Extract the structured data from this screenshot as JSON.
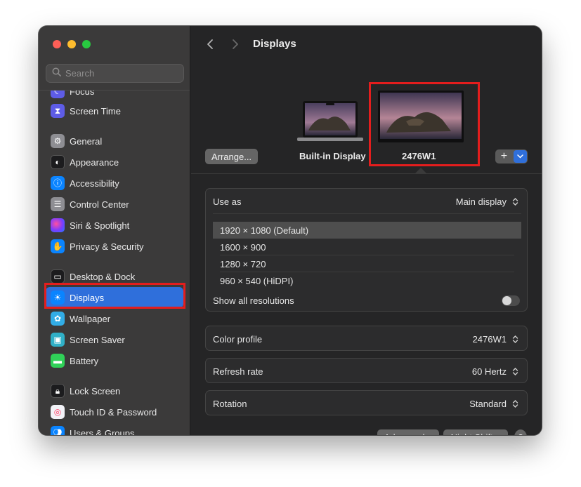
{
  "sidebar": {
    "search_placeholder": "Search",
    "items": [
      {
        "label": "Focus",
        "icon": "moon-icon",
        "color": "#5e5ce6"
      },
      {
        "label": "Screen Time",
        "icon": "hourglass-icon",
        "color": "#5e5ce6"
      },
      {
        "label": "General",
        "icon": "gear-icon",
        "color": "#8e8e93"
      },
      {
        "label": "Appearance",
        "icon": "appearance-icon",
        "color": "#1c1c1e"
      },
      {
        "label": "Accessibility",
        "icon": "accessibility-icon",
        "color": "#0a84ff"
      },
      {
        "label": "Control Center",
        "icon": "toggles-icon",
        "color": "#8e8e93"
      },
      {
        "label": "Siri & Spotlight",
        "icon": "siri-icon",
        "color": "#7a3cff"
      },
      {
        "label": "Privacy & Security",
        "icon": "hand-icon",
        "color": "#0a84ff"
      },
      {
        "label": "Desktop & Dock",
        "icon": "dock-icon",
        "color": "#1c1c1e"
      },
      {
        "label": "Displays",
        "icon": "sun-icon",
        "color": "#0a84ff"
      },
      {
        "label": "Wallpaper",
        "icon": "flower-icon",
        "color": "#32ade6"
      },
      {
        "label": "Screen Saver",
        "icon": "screensaver-icon",
        "color": "#30b0c7"
      },
      {
        "label": "Battery",
        "icon": "battery-icon",
        "color": "#30d158"
      },
      {
        "label": "Lock Screen",
        "icon": "lock-icon",
        "color": "#1c1c1e"
      },
      {
        "label": "Touch ID & Password",
        "icon": "fingerprint-icon",
        "color": "#f2f2f7"
      },
      {
        "label": "Users & Groups",
        "icon": "users-icon",
        "color": "#0a84ff"
      }
    ],
    "selected": "Displays"
  },
  "main": {
    "title": "Displays",
    "arrange_label": "Arrange...",
    "add_label": "+",
    "displays": [
      {
        "label": "Built-in Display"
      },
      {
        "label": "2476W1"
      }
    ],
    "use_as": {
      "label": "Use as",
      "value": "Main display"
    },
    "resolutions": [
      "1920 × 1080 (Default)",
      "1600 × 900",
      "1280 × 720",
      "960 × 540 (HiDPI)"
    ],
    "selected_resolution": "1920 × 1080 (Default)",
    "show_all_label": "Show all resolutions",
    "show_all_enabled": false,
    "color_profile": {
      "label": "Color profile",
      "value": "2476W1"
    },
    "refresh_rate": {
      "label": "Refresh rate",
      "value": "60 Hertz"
    },
    "rotation": {
      "label": "Rotation",
      "value": "Standard"
    },
    "bottom_buttons": [
      "Advanced...",
      "Night Shift...",
      "?"
    ]
  },
  "colors": {
    "accent": "#2f6fdb",
    "highlight": "#e41d1d"
  }
}
